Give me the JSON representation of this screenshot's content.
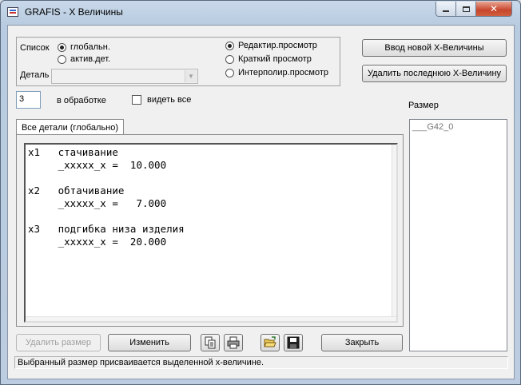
{
  "window": {
    "title": "GRAFIS - X Величины"
  },
  "list_group": {
    "label": "Список",
    "options": [
      {
        "label": "глобальн.",
        "selected": true
      },
      {
        "label": "актив.дет.",
        "selected": false
      }
    ],
    "detail_label": "Деталь",
    "detail_value": ""
  },
  "view_group": {
    "options": [
      {
        "label": "Редактир.просмотр",
        "selected": true
      },
      {
        "label": "Краткий просмотр",
        "selected": false
      },
      {
        "label": "Интерполир.просмотр",
        "selected": false
      }
    ]
  },
  "buttons": {
    "new_x": "Ввод новой X-Величины",
    "delete_last_x": "Удалить последнюю X-Величину",
    "delete_size": "Удалить размер",
    "change": "Изменить",
    "close": "Закрыть"
  },
  "processing": {
    "value": "3",
    "label": "в обработке"
  },
  "see_all": {
    "label": "видеть все",
    "checked": false
  },
  "tab": {
    "label": "Все детали (глобально)"
  },
  "editor_lines": [
    "x1   стачивание",
    "     _xxxxx_x =  10.000",
    "",
    "x2   обтачивание",
    "     _xxxxx_x =   7.000",
    "",
    "x3   подгибка низа изделия",
    "     _xxxxx_x =  20.000"
  ],
  "size_panel": {
    "label": "Размер",
    "items": [
      "___G42_0"
    ]
  },
  "toolbar_icons": [
    "copy-icon",
    "print-icon",
    "open-folder-icon",
    "save-icon"
  ],
  "status": {
    "text": "Выбранный размер присваивается выделенной х-величине."
  }
}
